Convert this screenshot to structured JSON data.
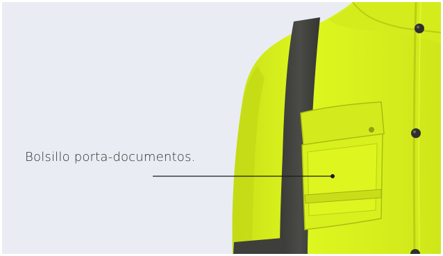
{
  "callout": {
    "text": "Bolsillo porta-documentos."
  },
  "colors": {
    "background": "#e9edf3",
    "jacket": "#d9f21d",
    "reflective_tape": "#3f403c",
    "leader_line": "#1a1a1a"
  },
  "icons": [
    "pocket-callout-dot"
  ]
}
